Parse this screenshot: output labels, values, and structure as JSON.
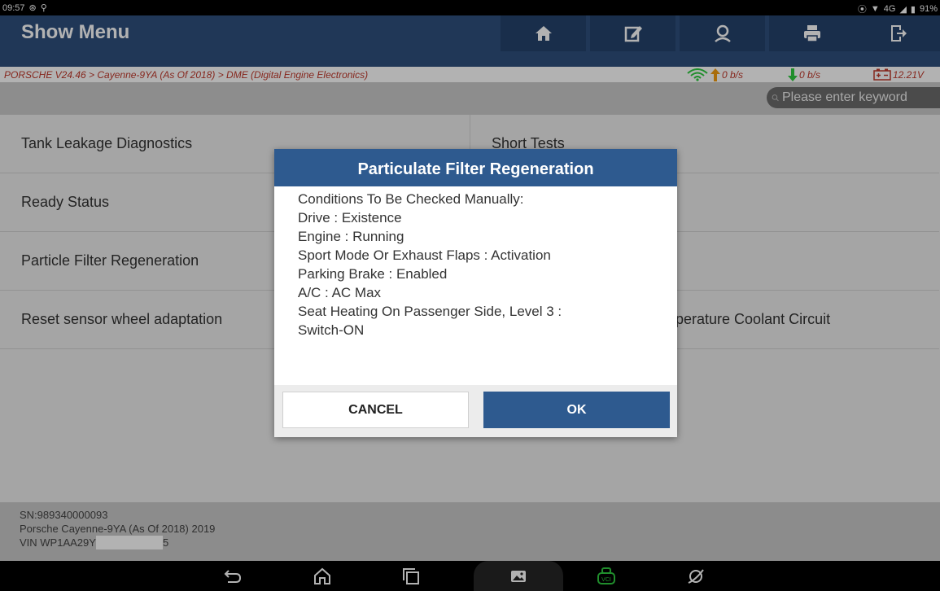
{
  "statusbar": {
    "time": "09:57",
    "network": "4G",
    "battery": "91%"
  },
  "header": {
    "title": "Show Menu",
    "buttons": [
      "home-icon",
      "edit-icon",
      "user-icon",
      "printer-icon",
      "exit-icon"
    ]
  },
  "breadcrumb": "PORSCHE V24.46 > Cayenne-9YA (As Of 2018) > DME (Digital Engine Electronics)",
  "netstats": {
    "upload": "0 b/s",
    "download": "0 b/s",
    "voltage": "12.21V"
  },
  "search": {
    "placeholder": "Please enter keyword"
  },
  "menu": {
    "left": [
      "Tank Leakage Diagnostics",
      "Ready Status",
      "Particle Filter Regeneration",
      "Reset sensor wheel adaptation"
    ],
    "right": [
      "Short Tests",
      "",
      "",
      "perature Coolant Circuit"
    ]
  },
  "info": {
    "sn": "SN:989340000093",
    "vehicle": "Porsche Cayenne-9YA (As Of 2018) 2019",
    "vin_prefix": "VIN WP1AA29Y",
    "vin_suffix": "5"
  },
  "dialog": {
    "title": "Particulate Filter Regeneration",
    "lines": [
      "Conditions To Be Checked Manually:",
      "Drive : Existence",
      "Engine : Running",
      "Sport Mode Or Exhaust Flaps : Activation",
      "Parking Brake : Enabled",
      "A/C : AC Max",
      "Seat Heating On Passenger Side, Level 3 :",
      "Switch-ON"
    ],
    "cancel": "CANCEL",
    "ok": "OK"
  },
  "colors": {
    "header": "#2e4f7d",
    "dialog_title": "#2e5a8f",
    "breadcrumb": "#c0392b",
    "vci": "#2ecc40"
  }
}
